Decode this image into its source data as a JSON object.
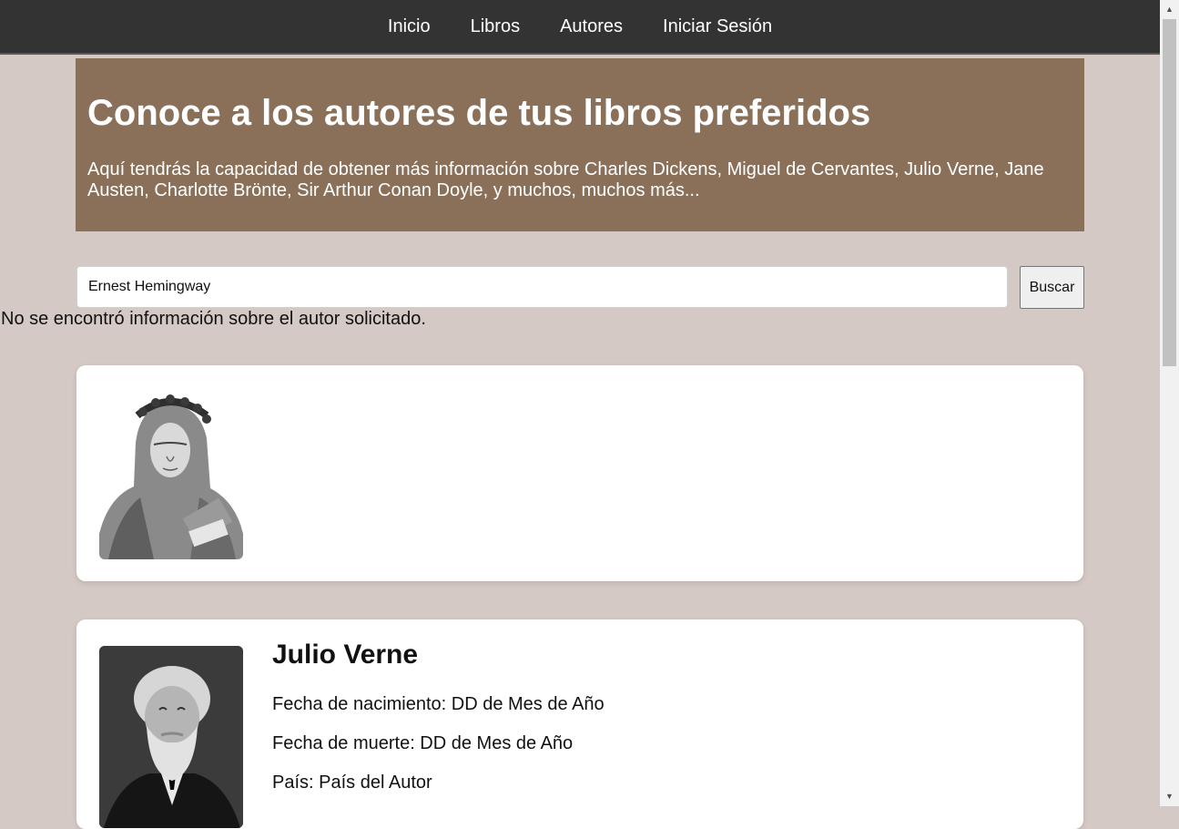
{
  "nav": {
    "items": [
      {
        "label": "Inicio"
      },
      {
        "label": "Libros"
      },
      {
        "label": "Autores"
      },
      {
        "label": "Iniciar Sesión"
      }
    ]
  },
  "hero": {
    "title": "Conoce a los autores de tus libros preferidos",
    "subtitle": "Aquí tendrás la capacidad de obtener más información sobre Charles Dickens, Miguel de Cervantes, Julio Verne, Jane Austen, Charlotte Brönte, Sir Arthur Conan Doyle, y muchos, muchos más..."
  },
  "search": {
    "value": "Ernest Hemingway",
    "button_label": "Buscar"
  },
  "message": "No se encontró información sobre el autor solicitado.",
  "authors": [
    {
      "name": "",
      "portrait_icon": "laurel-crowned-poet-engraving"
    },
    {
      "name": "Julio Verne",
      "portrait_icon": "bearded-man-photo",
      "birth": "Fecha de nacimiento: DD de Mes de Año",
      "death": "Fecha de muerte: DD de Mes de Año",
      "country": "País: País del Autor"
    }
  ],
  "colors": {
    "background": "#d4c9c4",
    "navbar": "#333333",
    "hero": "#8a7059"
  },
  "scrollbar": {
    "up_icon": "▲",
    "down_icon": "▼"
  }
}
